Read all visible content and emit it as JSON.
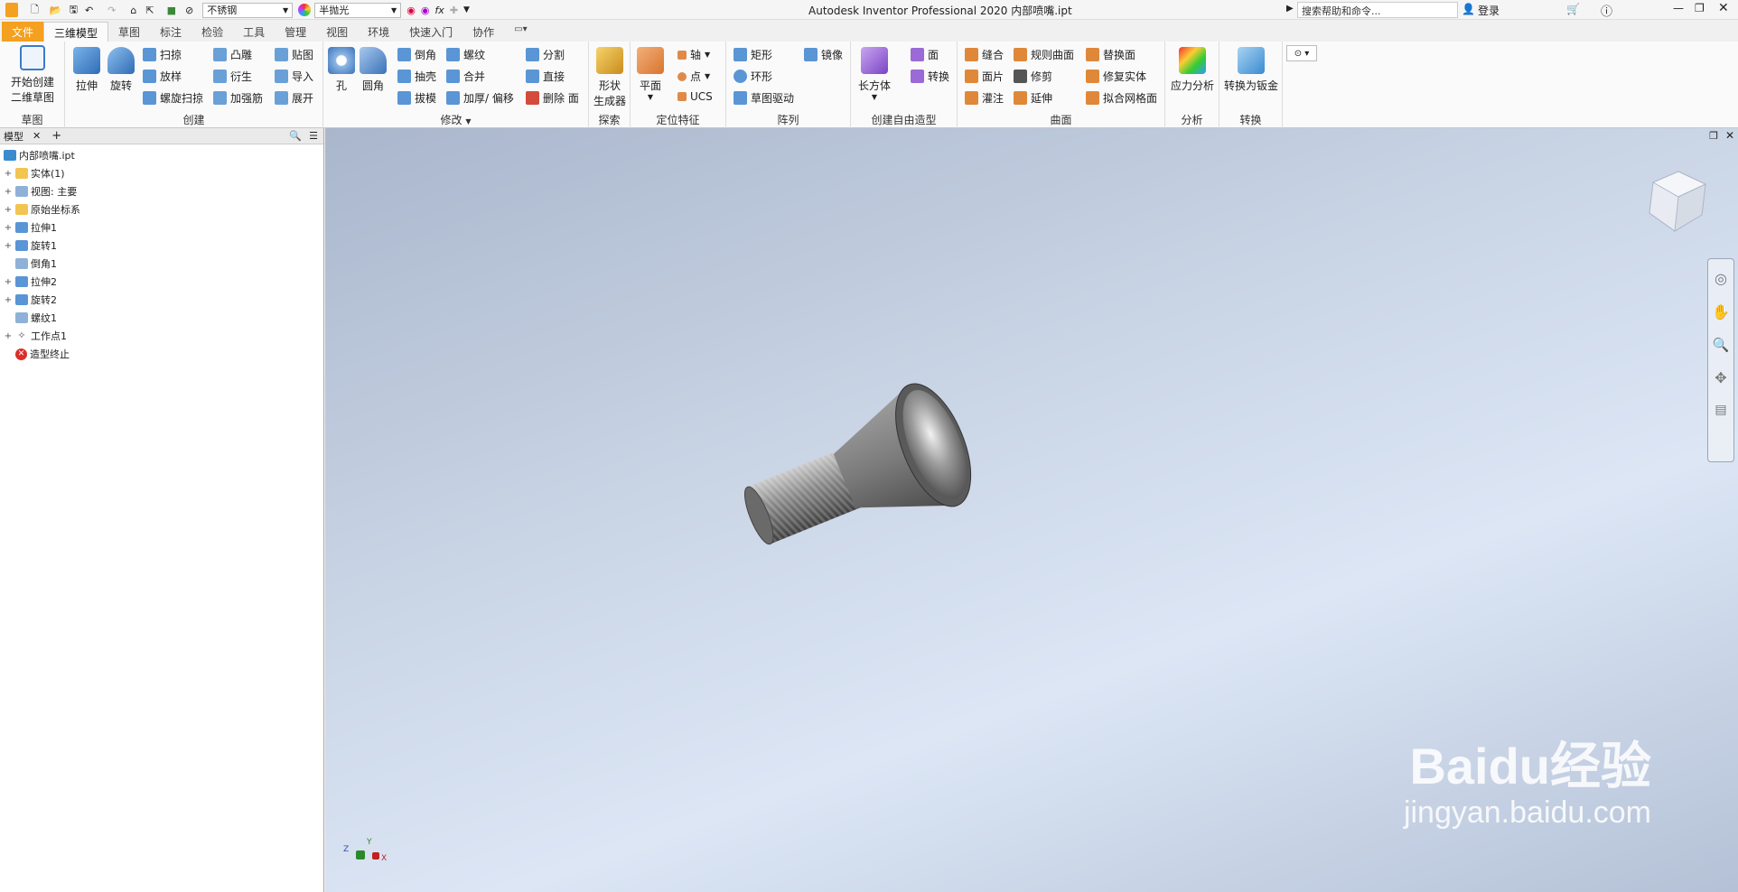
{
  "titlebar": {
    "material": "不锈钢",
    "appearance": "半抛光",
    "title": "Autodesk Inventor Professional 2020    内部喷嘴.ipt",
    "search_placeholder": "搜索帮助和命令...",
    "login": "登录"
  },
  "tabs": [
    "文件",
    "三维模型",
    "草图",
    "标注",
    "检验",
    "工具",
    "管理",
    "视图",
    "环境",
    "快速入门",
    "协作"
  ],
  "ribbon": {
    "sketch": {
      "start_line1": "开始创建",
      "start_line2": "二维草图",
      "panel": "草图"
    },
    "create": {
      "extrude": "拉伸",
      "revolve": "旋转",
      "sweep": "扫掠",
      "loft": "放样",
      "coil": "螺旋扫掠",
      "emboss": "凸雕",
      "derive": "衍生",
      "rib": "加强筋",
      "decal": "贴图",
      "import": "导入",
      "unfold": "展开",
      "panel": "创建"
    },
    "modify": {
      "hole": "孔",
      "fillet": "圆角",
      "chamfer": "倒角",
      "shell": "抽壳",
      "draft": "拔模",
      "thread": "螺纹",
      "combine": "合并",
      "thicken": "加厚/ 偏移",
      "split": "分割",
      "direct": "直接",
      "delete_face": "删除 面",
      "panel": "修改"
    },
    "explore": {
      "shape_line1": "形状",
      "shape_line2": "生成器",
      "panel": "探索"
    },
    "workfeat": {
      "plane": "平面",
      "axis": "轴",
      "point": "点",
      "ucs": "UCS",
      "panel": "定位特征"
    },
    "pattern": {
      "rect": "矩形",
      "circ": "环形",
      "sketch_driven": "草图驱动",
      "mirror": "镜像",
      "panel": "阵列"
    },
    "freeform": {
      "box": "长方体",
      "face": "面",
      "convert": "转换",
      "panel": "创建自由造型"
    },
    "surface": {
      "stitch": "缝合",
      "patch": "面片",
      "sculpt": "灌注",
      "ruled": "规则曲面",
      "trim": "修剪",
      "extend": "延伸",
      "replace": "替换面",
      "repair": "修复实体",
      "fit_mesh": "拟合网格面",
      "panel": "曲面"
    },
    "analysis": {
      "stress": "应力分析",
      "panel": "分析"
    },
    "convert": {
      "sheetmetal": "转换为钣金",
      "panel": "转换"
    }
  },
  "browser": {
    "tab": "模型",
    "nodes": [
      {
        "label": "内部喷嘴.ipt"
      },
      {
        "label": "实体(1)"
      },
      {
        "label": "视图: 主要"
      },
      {
        "label": "原始坐标系"
      },
      {
        "label": "拉伸1"
      },
      {
        "label": "旋转1"
      },
      {
        "label": "倒角1"
      },
      {
        "label": "拉伸2"
      },
      {
        "label": "旋转2"
      },
      {
        "label": "螺纹1"
      },
      {
        "label": "工作点1"
      },
      {
        "label": "造型终止"
      }
    ]
  },
  "viewport": {
    "axes": {
      "x": "X",
      "y": "Y",
      "z": "Z"
    },
    "watermark_brand": "Baidu经验",
    "watermark_url": "jingyan.baidu.com"
  },
  "colors": {
    "file_tab": "#f4a020",
    "viewport_top": "#a9b6cc",
    "viewport_mid": "#dce6f5",
    "error": "#d9302b"
  }
}
